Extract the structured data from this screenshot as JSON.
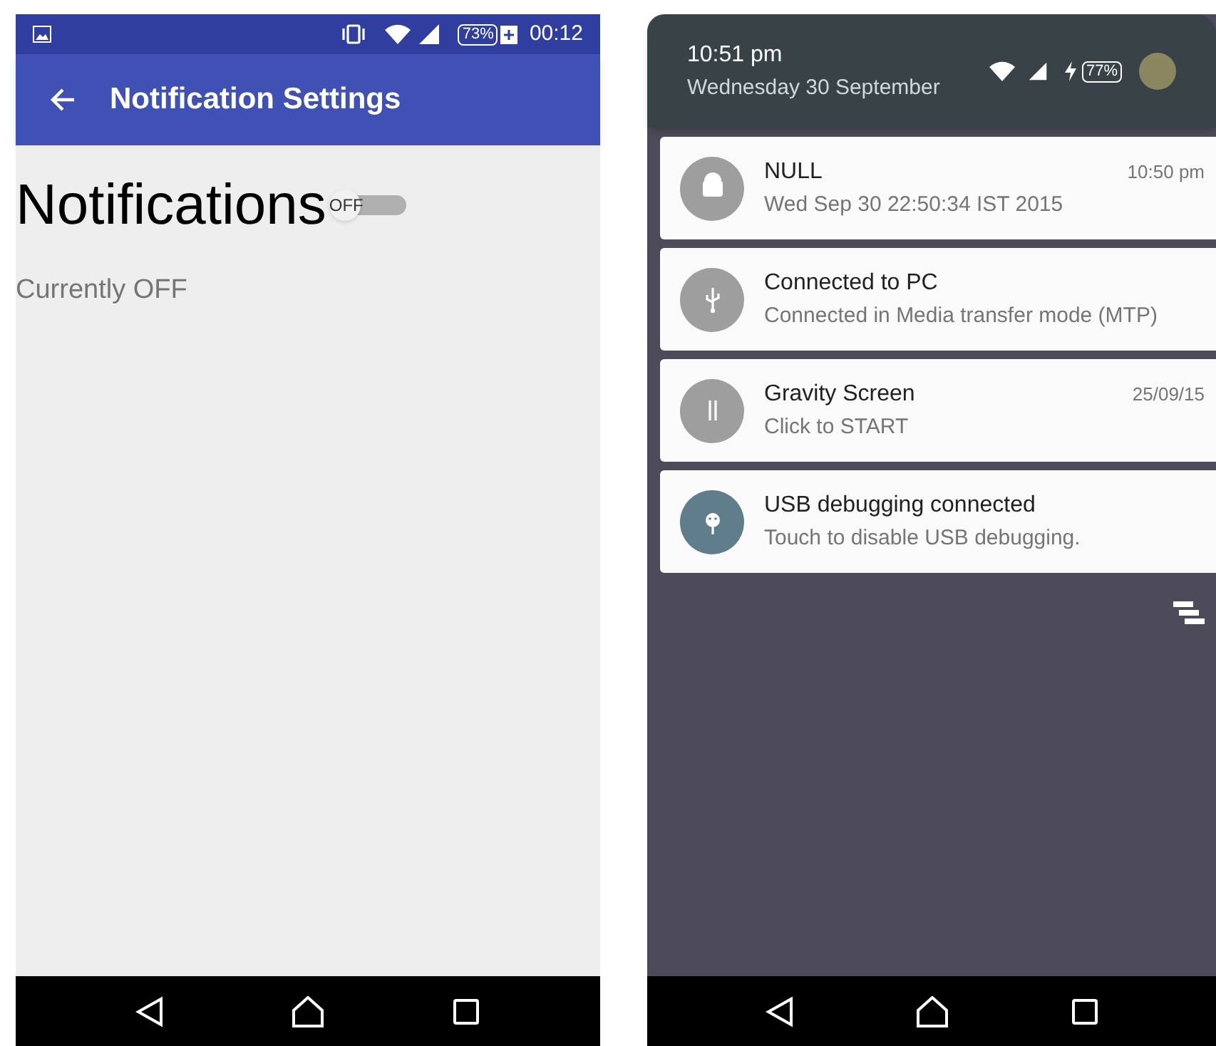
{
  "settings_screen": {
    "status_bar": {
      "battery": "73%",
      "time": "00:12"
    },
    "app_bar": {
      "title": "Notification Settings"
    },
    "heading": "Notifications",
    "switch": {
      "label": "OFF",
      "on": false
    },
    "status_text": "Currently OFF"
  },
  "shade_screen": {
    "header": {
      "time": "10:51 pm",
      "date": "Wednesday 30 September",
      "battery": "77%"
    },
    "notifications": [
      {
        "title": "NULL",
        "text": "Wed Sep 30 22:50:34 IST 2015",
        "time": "10:50 pm",
        "color": "#9e9e9e"
      },
      {
        "title": "Connected to PC",
        "text": "Connected in Media transfer mode (MTP)",
        "color": "#9e9e9e"
      },
      {
        "title": "Gravity Screen",
        "text": "Click to START",
        "time": "25/09/15",
        "color": "#9e9e9e"
      },
      {
        "title": "USB debugging connected",
        "text": "Touch to disable USB debugging.",
        "color": "#607d8b"
      }
    ]
  }
}
